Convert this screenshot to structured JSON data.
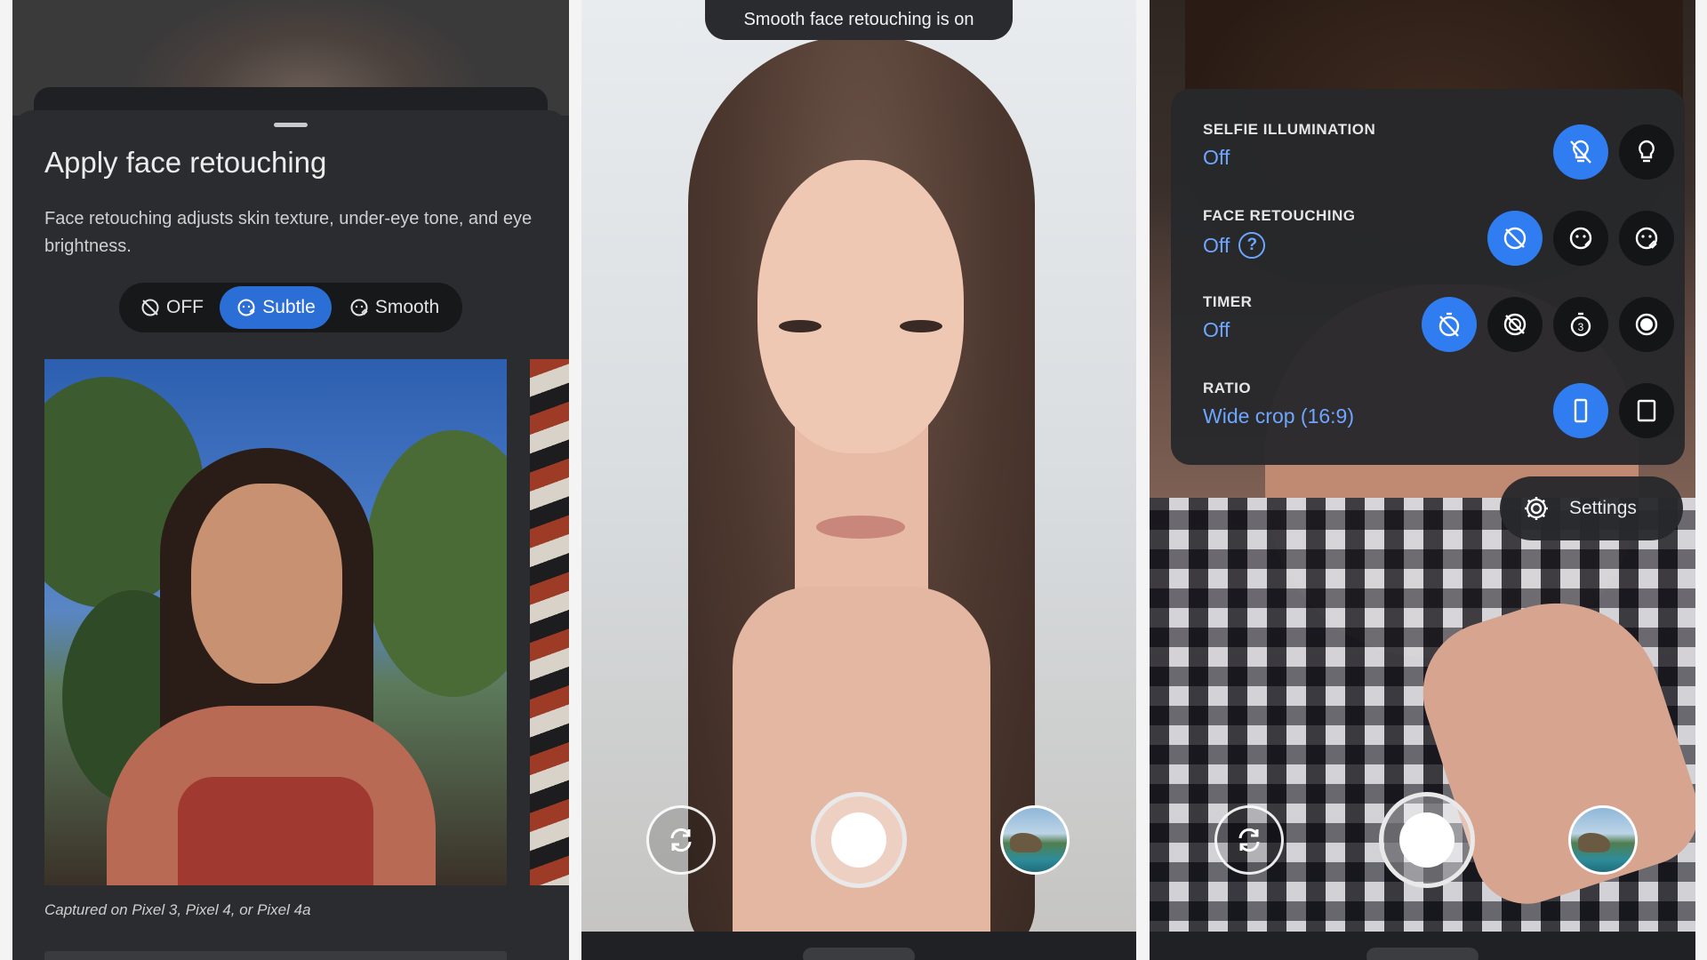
{
  "panel1": {
    "title": "Apply face retouching",
    "description": "Face retouching adjusts skin texture, under-eye tone, and eye brightness.",
    "options": [
      {
        "label": "OFF",
        "icon": "face-retouch-off-icon",
        "selected": false
      },
      {
        "label": "Subtle",
        "icon": "face-retouch-subtle-icon",
        "selected": true
      },
      {
        "label": "Smooth",
        "icon": "face-retouch-smooth-icon",
        "selected": false
      }
    ],
    "caption": "Captured on Pixel 3, Pixel 4, or Pixel 4a"
  },
  "panel2": {
    "toast": "Smooth face retouching is on",
    "controls": {
      "flip": "switch-camera-icon",
      "shutter": "shutter-button",
      "gallery": "gallery-thumbnail"
    }
  },
  "panel3": {
    "quick_settings": [
      {
        "label": "SELFIE ILLUMINATION",
        "value": "Off",
        "options": [
          "illumination-off-icon",
          "illumination-on-icon"
        ],
        "selected": 0
      },
      {
        "label": "FACE RETOUCHING",
        "value": "Off",
        "help": "?",
        "options": [
          "retouch-off-icon",
          "retouch-subtle-icon",
          "retouch-smooth-icon"
        ],
        "selected": 0
      },
      {
        "label": "TIMER",
        "value": "Off",
        "options": [
          "timer-off-icon",
          "timer-3s-off-icon",
          "timer-3s-icon",
          "timer-10s-icon"
        ],
        "selected": 0
      },
      {
        "label": "RATIO",
        "value": "Wide crop (16:9)",
        "options": [
          "ratio-16-9-icon",
          "ratio-4-3-icon"
        ],
        "selected": 0
      }
    ],
    "settings_label": "Settings"
  },
  "colors": {
    "accent": "#2f7df0",
    "link_blue": "#6ea6ff",
    "panel_dark": "#2b2c2f",
    "subtle_pill": "#2b6fd6"
  }
}
